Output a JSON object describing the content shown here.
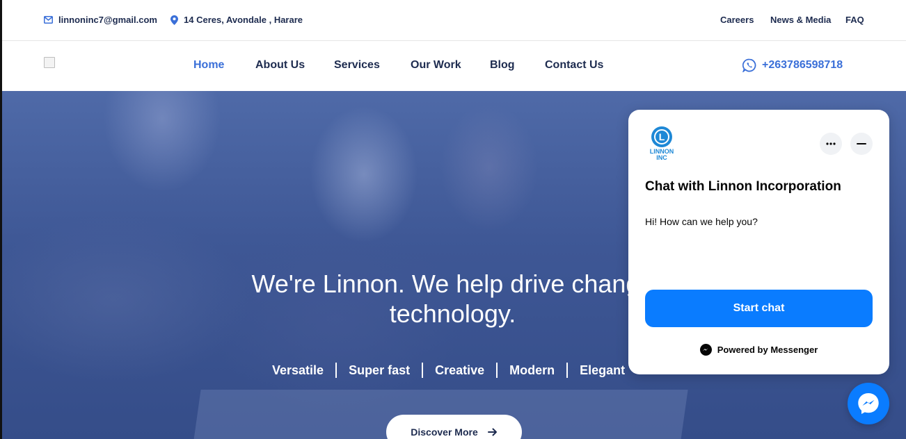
{
  "topbar": {
    "email": "linnoninc7@gmail.com",
    "address": "14 Ceres, Avondale , Harare",
    "links": [
      "Careers",
      "News & Media",
      "FAQ"
    ]
  },
  "nav": {
    "items": [
      "Home",
      "About Us",
      "Services",
      "Our Work",
      "Blog",
      "Contact Us"
    ],
    "active": "Home",
    "phone": "+263786598718"
  },
  "hero": {
    "title": "We're Linnon. We help drive change technology.",
    "title_line1": "We're Linnon. We help drive change",
    "title_line2": "technology.",
    "tags": [
      "Versatile",
      "Super fast",
      "Creative",
      "Modern",
      "Elegant"
    ],
    "cta": "Discover More"
  },
  "chat": {
    "brand_letter": "L",
    "brand_name_line1": "LINNON",
    "brand_name_line2": "INC",
    "title": "Chat with Linnon Incorporation",
    "message": "Hi! How can we help you?",
    "button": "Start chat",
    "powered_by": "Powered by Messenger"
  },
  "colors": {
    "accent": "#3a6fd8",
    "navy": "#1d2b4f",
    "messenger_blue": "#0a7cff",
    "hero_overlay": "#3e5795"
  },
  "icons": [
    "mail-icon",
    "location-pin-icon",
    "whatsapp-icon",
    "more-icon",
    "minimize-icon",
    "messenger-icon",
    "arrow-right-icon"
  ]
}
